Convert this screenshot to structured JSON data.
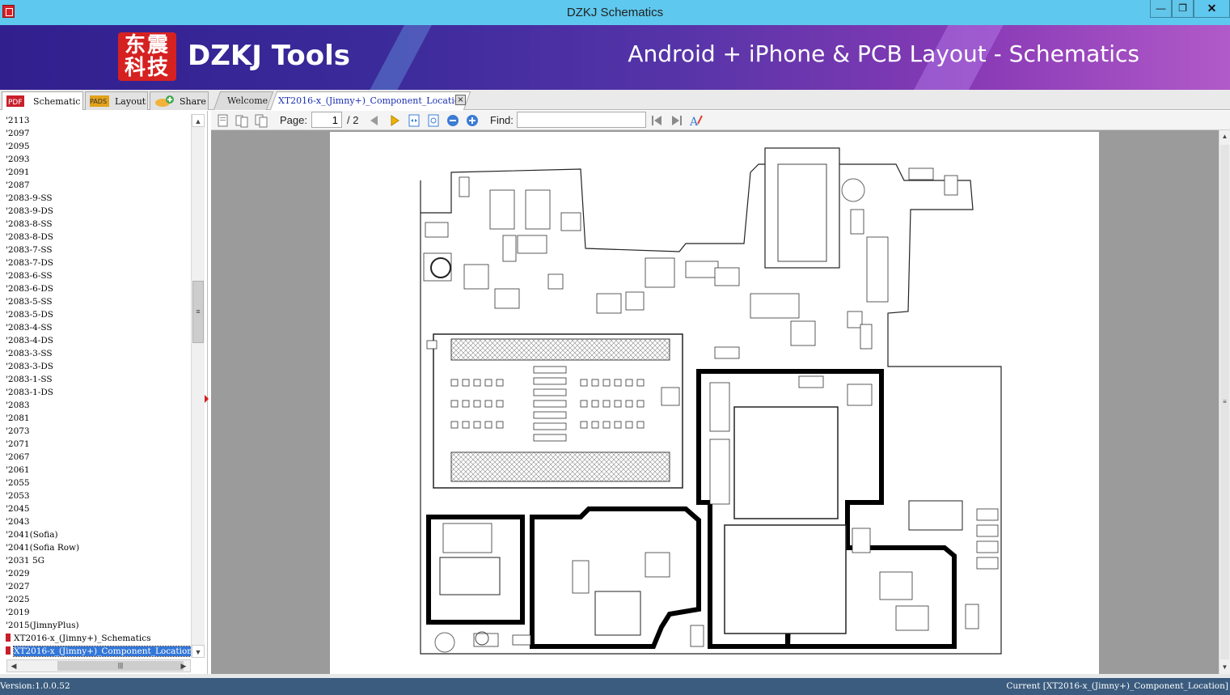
{
  "window": {
    "title": "DZKJ Schematics",
    "minimize_glyph": "—",
    "maximize_glyph": "❐",
    "close_glyph": "✕"
  },
  "banner": {
    "logo_chars": "东震科技",
    "brand": "DZKJ Tools",
    "tagline": "Android + iPhone & PCB Layout - Schematics"
  },
  "left_tabs": [
    {
      "label": "Schematic",
      "icon": "pdf-icon",
      "icon_text": "PDF"
    },
    {
      "label": "Layout",
      "icon": "pads-icon",
      "icon_text": "PADS"
    },
    {
      "label": "Share",
      "icon": "cloud-share-icon"
    }
  ],
  "doc_tabs": [
    {
      "label": "Welcome"
    },
    {
      "label": "XT2016-x_(Jimny+)_Component_Location"
    }
  ],
  "file_list": [
    "'2113",
    "'2097",
    "'2095",
    "'2093",
    "'2091",
    "'2087",
    "'2083-9-SS",
    "'2083-9-DS",
    "'2083-8-SS",
    "'2083-8-DS",
    "'2083-7-SS",
    "'2083-7-DS",
    "'2083-6-SS",
    "'2083-6-DS",
    "'2083-5-SS",
    "'2083-5-DS",
    "'2083-4-SS",
    "'2083-4-DS",
    "'2083-3-SS",
    "'2083-3-DS",
    "'2083-1-SS",
    "'2083-1-DS",
    "'2083",
    "'2081",
    "'2073",
    "'2071",
    "'2067",
    "'2061",
    "'2055",
    "'2053",
    "'2045",
    "'2043",
    "'2041(Sofia)",
    "'2041(Sofia Row)",
    "'2031 5G",
    "'2029",
    "'2027",
    "'2025",
    "'2019",
    "'2015(JimnyPlus)",
    "XT2016-x_(Jimny+)_Schematics",
    "XT2016-x_(Jimny+)_Component_Location"
  ],
  "selected_file_index": 41,
  "toolbar": {
    "page_label": "Page:",
    "page_current": "1",
    "page_total": "/ 2",
    "find_label": "Find:",
    "find_value": ""
  },
  "statusbar": {
    "version": "Version:1.0.0.52",
    "current": "Current [XT2016-x_(Jimny+)_Component_Location]"
  },
  "colors": {
    "titlebar": "#5fc8ee",
    "banner_start": "#321f8e",
    "banner_end": "#b15ac9",
    "selection": "#3377d8",
    "viewer_bg": "#9b9b9b",
    "statusbar": "#3b5c7e"
  }
}
